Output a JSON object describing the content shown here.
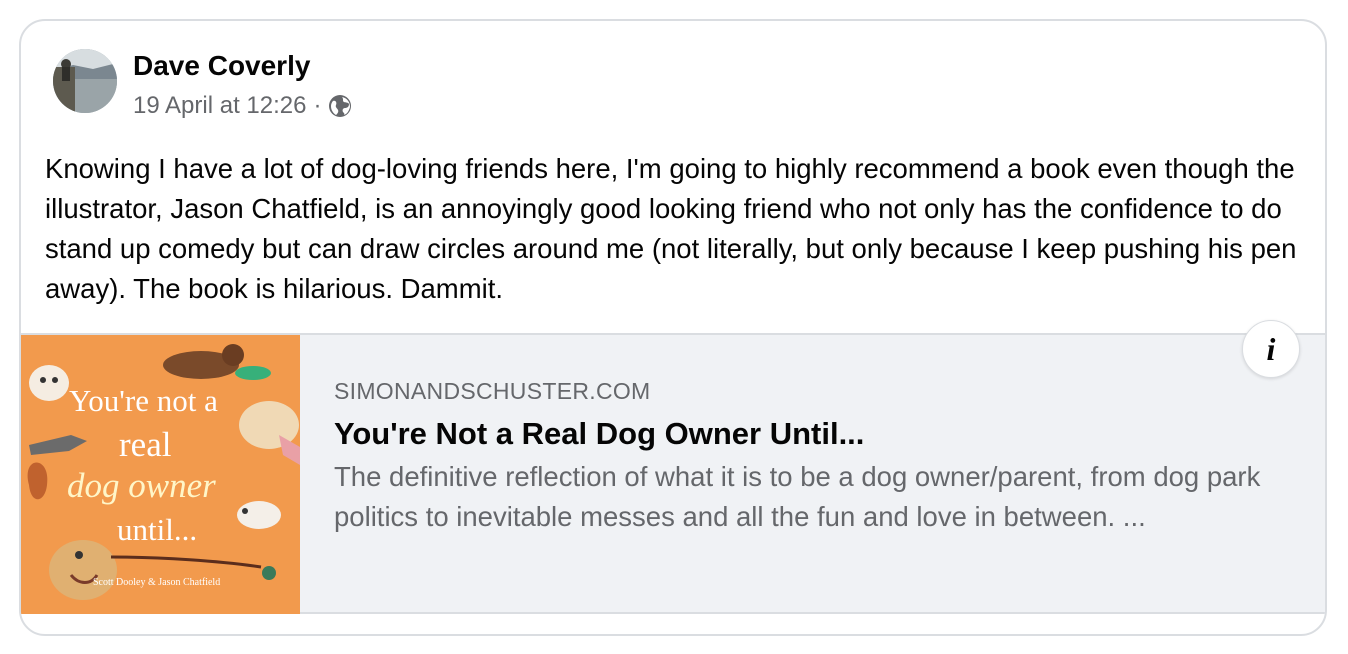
{
  "post": {
    "author": "Dave Coverly",
    "timestamp": "19 April at 12:26",
    "separator": "·",
    "audience_icon": "globe-icon",
    "text": "Knowing I have a lot of dog-loving friends here, I'm going to highly recommend a book even though the illustrator, Jason Chatfield, is an annoyingly good looking friend who not only has the confidence to do stand up comedy but can draw circles around me (not literally, but only because I keep pushing his pen away). The book is hilarious. Dammit."
  },
  "link_preview": {
    "domain": "SIMONANDSCHUSTER.COM",
    "title": "You're Not a Real Dog Owner Until...",
    "description": "The definitive reflection of what it is to be a dog owner/parent, from dog park politics to inevitable messes and all the fun and love in between. ...",
    "info_icon": "info-icon",
    "info_glyph": "i",
    "cover": {
      "line1": "You're not a",
      "line2": "real",
      "line3": "dog owner",
      "line4": "until...",
      "authors": "Scott Dooley & Jason Chatfield",
      "background_color": "#f29a4d"
    }
  },
  "colors": {
    "text_primary": "#050505",
    "text_secondary": "#65676b",
    "card_background": "#f0f2f5",
    "border": "#dadde1"
  }
}
